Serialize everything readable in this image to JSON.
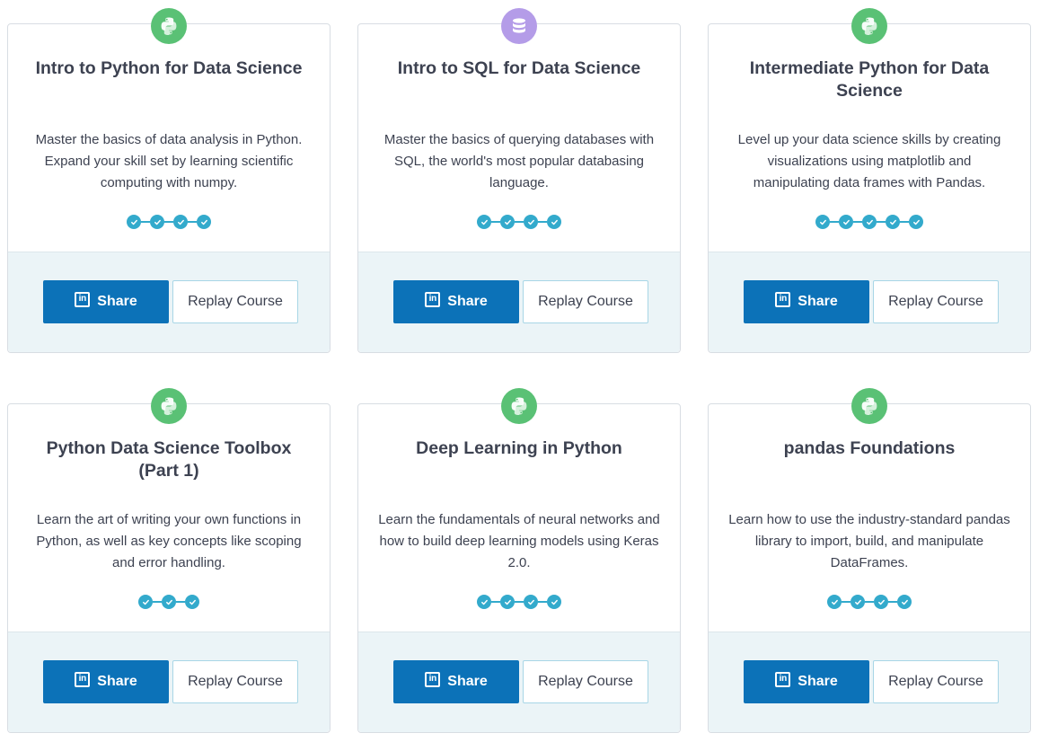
{
  "colors": {
    "python_badge": "#5ac175",
    "sql_badge": "#b49ce8",
    "progress": "#33aacc",
    "share_button": "#0c72b8",
    "footer_bg": "#ebf4f7"
  },
  "courses": [
    {
      "icon": "python-icon",
      "title": "Intro to Python for Data Science",
      "description": "Master the basics of data analysis in Python. Expand your skill set by learning scientific computing with numpy.",
      "chapters_completed": 4,
      "share_label": "Share",
      "linkedin_glyph": "in",
      "replay_label": "Replay Course"
    },
    {
      "icon": "database-icon",
      "title": "Intro to SQL for Data Science",
      "description": "Master the basics of querying databases with SQL, the world's most popular databasing language.",
      "chapters_completed": 4,
      "share_label": "Share",
      "linkedin_glyph": "in",
      "replay_label": "Replay Course"
    },
    {
      "icon": "python-icon",
      "title": "Intermediate Python for Data Science",
      "description": "Level up your data science skills by creating visualizations using matplotlib and manipulating data frames with Pandas.",
      "chapters_completed": 5,
      "share_label": "Share",
      "linkedin_glyph": "in",
      "replay_label": "Replay Course"
    },
    {
      "icon": "python-icon",
      "title": "Python Data Science Toolbox (Part 1)",
      "description": "Learn the art of writing your own functions in Python, as well as key concepts like scoping and error handling.",
      "chapters_completed": 3,
      "share_label": "Share",
      "linkedin_glyph": "in",
      "replay_label": "Replay Course"
    },
    {
      "icon": "python-icon",
      "title": "Deep Learning in Python",
      "description": "Learn the fundamentals of neural networks and how to build deep learning models using Keras 2.0.",
      "chapters_completed": 4,
      "share_label": "Share",
      "linkedin_glyph": "in",
      "replay_label": "Replay Course"
    },
    {
      "icon": "python-icon",
      "title": "pandas Foundations",
      "description": "Learn how to use the industry-standard pandas library to import, build, and manipulate DataFrames.",
      "chapters_completed": 4,
      "share_label": "Share",
      "linkedin_glyph": "in",
      "replay_label": "Replay Course"
    }
  ]
}
